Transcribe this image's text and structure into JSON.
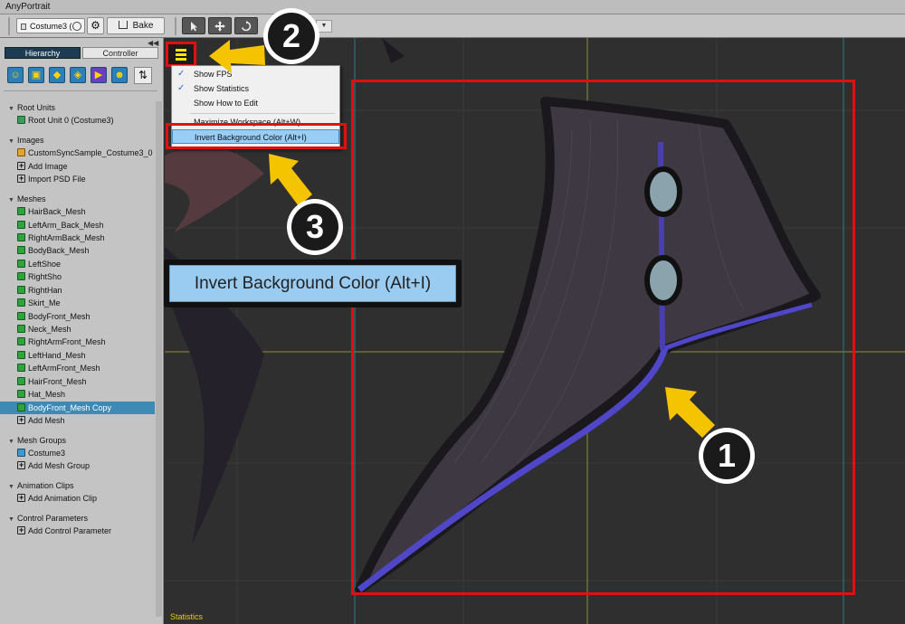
{
  "window": {
    "title": "AnyPortrait"
  },
  "toolbar": {
    "mesh_group_dropdown": "Costume3 (",
    "bake_label": "Bake",
    "tool_icons": [
      "select-arrow-icon",
      "move-icon",
      "rotate-icon"
    ]
  },
  "left_panel": {
    "tabs": [
      "Hierarchy",
      "Controller"
    ],
    "active_tab": "Hierarchy",
    "filter_icons": [
      "root-unit-icon",
      "image-icon",
      "mesh-icon",
      "mesh-group-icon",
      "animation-icon",
      "control-parameter-icon"
    ],
    "sections": [
      {
        "title": "Root Units",
        "items": [
          {
            "label": "Root Unit 0 (Costume3)",
            "icon": "unit"
          }
        ]
      },
      {
        "title": "Images",
        "items": [
          {
            "label": "CustomSyncSample_Costume3_0",
            "icon": "img"
          },
          {
            "label": "Add Image",
            "icon": "plus"
          },
          {
            "label": "Import PSD File",
            "icon": "plus"
          }
        ]
      },
      {
        "title": "Meshes",
        "items": [
          {
            "label": "HairBack_Mesh",
            "icon": "mesh"
          },
          {
            "label": "LeftArm_Back_Mesh",
            "icon": "mesh"
          },
          {
            "label": "RightArmBack_Mesh",
            "icon": "mesh"
          },
          {
            "label": "BodyBack_Mesh",
            "icon": "mesh"
          },
          {
            "label": "LeftShoe",
            "icon": "mesh"
          },
          {
            "label": "RightSho",
            "icon": "mesh"
          },
          {
            "label": "RightHan",
            "icon": "mesh"
          },
          {
            "label": "Skirt_Me",
            "icon": "mesh"
          },
          {
            "label": "BodyFront_Mesh",
            "icon": "mesh"
          },
          {
            "label": "Neck_Mesh",
            "icon": "mesh"
          },
          {
            "label": "RightArmFront_Mesh",
            "icon": "mesh"
          },
          {
            "label": "LeftHand_Mesh",
            "icon": "mesh"
          },
          {
            "label": "LeftArmFront_Mesh",
            "icon": "mesh"
          },
          {
            "label": "HairFront_Mesh",
            "icon": "mesh"
          },
          {
            "label": "Hat_Mesh",
            "icon": "mesh"
          },
          {
            "label": "BodyFront_Mesh Copy",
            "icon": "mesh",
            "selected": true
          },
          {
            "label": "Add Mesh",
            "icon": "plus"
          }
        ]
      },
      {
        "title": "Mesh Groups",
        "items": [
          {
            "label": "Costume3",
            "icon": "grp"
          },
          {
            "label": "Add Mesh Group",
            "icon": "plus"
          }
        ]
      },
      {
        "title": "Animation Clips",
        "items": [
          {
            "label": "Add Animation Clip",
            "icon": "plus"
          }
        ]
      },
      {
        "title": "Control Parameters",
        "items": [
          {
            "label": "Add Control Parameter",
            "icon": "plus"
          }
        ]
      }
    ]
  },
  "menu": {
    "items": [
      {
        "label": "Show FPS",
        "checked": true
      },
      {
        "label": "Show Statistics",
        "checked": true
      },
      {
        "label": "Show How to Edit",
        "checked": false
      },
      {
        "label": "Maximize Workspace (Alt+W)",
        "checked": false
      },
      {
        "label": "Invert Background Color (Alt+I)",
        "checked": false,
        "highlighted": true
      }
    ]
  },
  "callout": {
    "text": "Invert Background Color (Alt+I)"
  },
  "steps": [
    "1",
    "2",
    "3"
  ],
  "viewport": {
    "statistics_label": "Statistics"
  },
  "colors": {
    "highlight_red": "#e01010",
    "arrow_yellow": "#f5c400",
    "selection": "#3e8ab4",
    "menu_highlight": "#99cdf3"
  }
}
